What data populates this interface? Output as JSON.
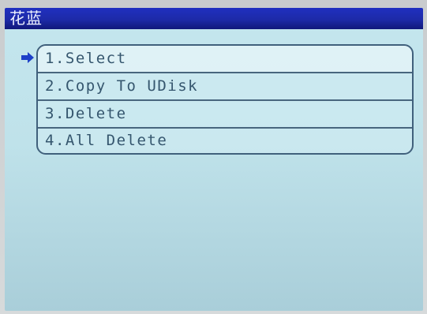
{
  "title": "花蓝",
  "menu": {
    "selected_index": 0,
    "items": [
      {
        "label": "1.Select"
      },
      {
        "label": "2.Copy To UDisk"
      },
      {
        "label": "3.Delete"
      },
      {
        "label": "4.All Delete"
      }
    ]
  },
  "icons": {
    "pointer": "arrow-right-icon"
  },
  "colors": {
    "title_bar": "#1d2aa8",
    "screen_bg": "#c4e6ee",
    "menu_text": "#35566e",
    "pointer": "#1d40c8"
  }
}
